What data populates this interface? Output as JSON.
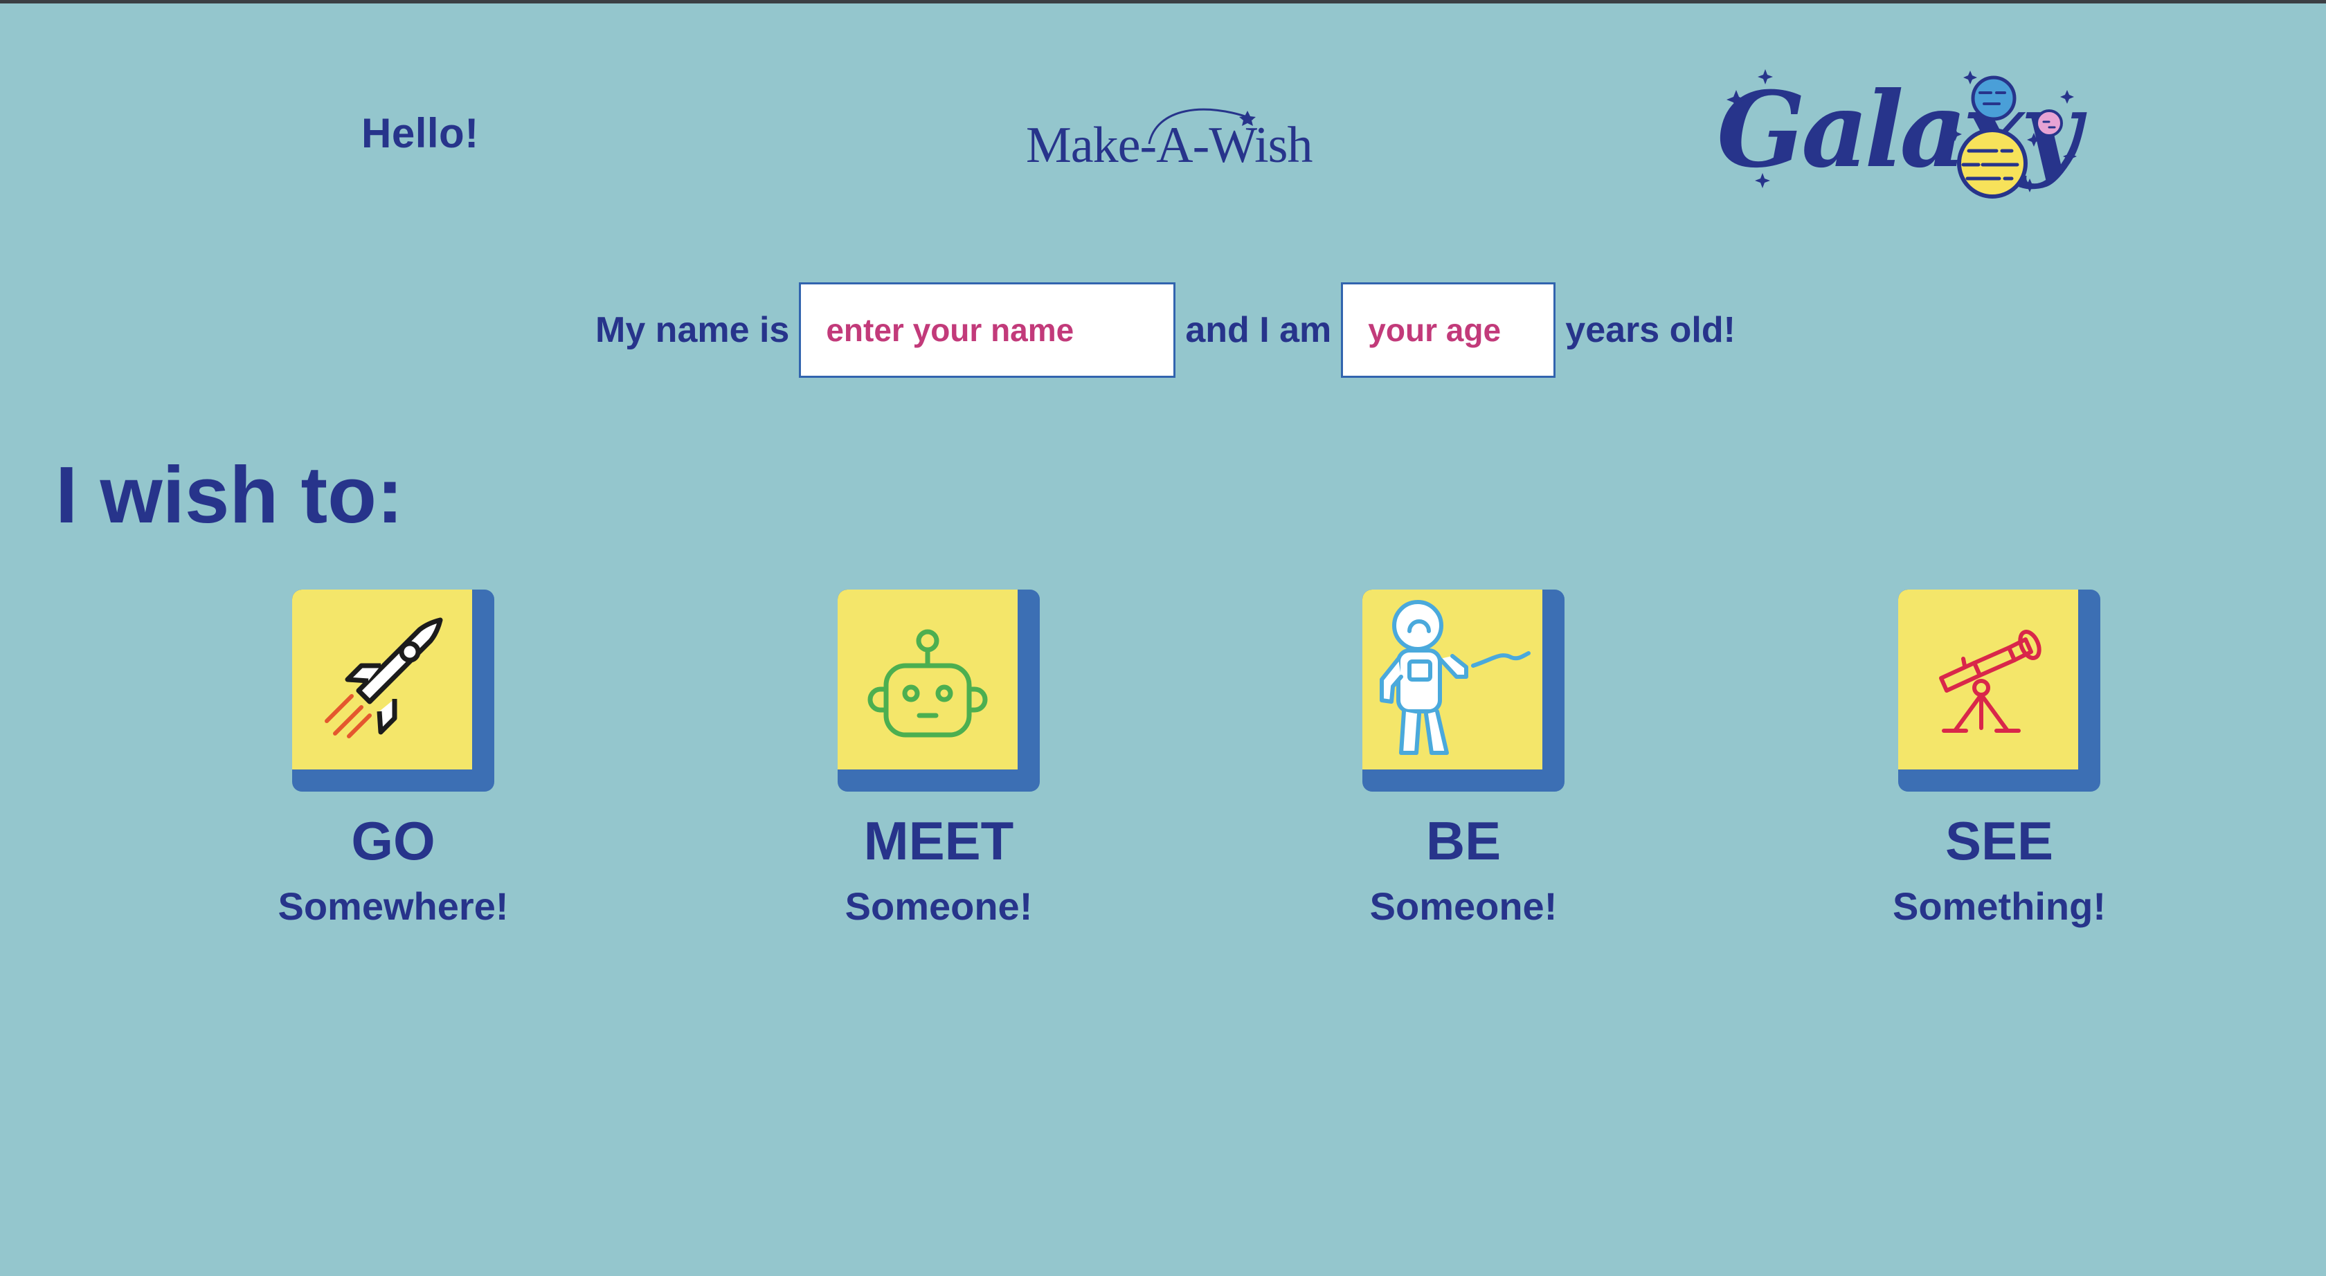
{
  "greeting": "Hello!",
  "logos": {
    "make_a_wish": "Make-A-Wish",
    "galaxy": "Galaxy"
  },
  "intro": {
    "prefix": "My name is",
    "name_placeholder": "enter your name",
    "name_value": "",
    "middle": "and I am",
    "age_placeholder": "your age",
    "age_value": "",
    "suffix": "years old!"
  },
  "wish_heading": "I wish to:",
  "wish_options": [
    {
      "title": "GO",
      "subtitle": "Somewhere!",
      "icon": "rocket-icon"
    },
    {
      "title": "MEET",
      "subtitle": "Someone!",
      "icon": "robot-icon"
    },
    {
      "title": "BE",
      "subtitle": "Someone!",
      "icon": "astronaut-icon"
    },
    {
      "title": "SEE",
      "subtitle": "Something!",
      "icon": "telescope-icon"
    }
  ],
  "colors": {
    "background": "#94c6cd",
    "text": "#27348b",
    "tile_face": "#f4e66a",
    "tile_shadow": "#3c6fb4",
    "input_text": "#c23a7a"
  }
}
